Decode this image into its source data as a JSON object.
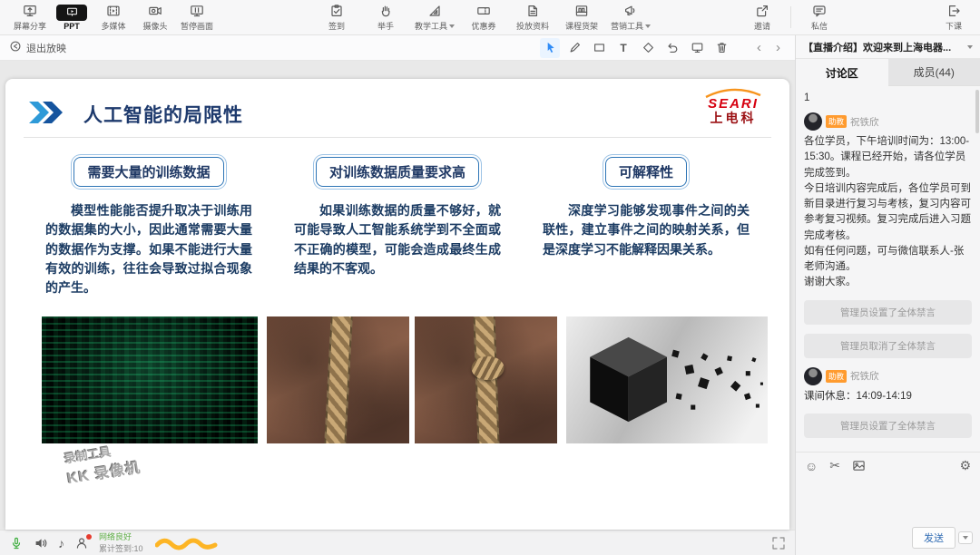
{
  "topbar": {
    "items_left": [
      {
        "label": "屏幕分享"
      },
      {
        "label": "PPT",
        "active": true
      },
      {
        "label": "多媒体"
      },
      {
        "label": "摄像头"
      },
      {
        "label": "暂停画面"
      }
    ],
    "items_center": [
      {
        "label": "签到"
      },
      {
        "label": "举手"
      },
      {
        "label": "教学工具",
        "has_dropdown": true
      },
      {
        "label": "优惠券"
      },
      {
        "label": "投放资料"
      },
      {
        "label": "课程货架"
      },
      {
        "label": "营销工具",
        "has_dropdown": true
      }
    ],
    "items_right": [
      {
        "label": "邀请"
      },
      {
        "label": "私信"
      },
      {
        "label": "下课"
      }
    ]
  },
  "presenter_bar": {
    "exit_label": "退出放映",
    "tools": [
      "select-tool",
      "pen-tool",
      "rectangle-tool",
      "text-tool",
      "eraser-tool",
      "undo-tool",
      "clear-screen-tool",
      "delete-annotations-tool"
    ],
    "selected_tool": "select-tool"
  },
  "icons": {
    "emoji": "☺",
    "cut": "✂",
    "settings": "⚙",
    "music": "♪",
    "prev": "‹",
    "next": "›",
    "text_tool": "T"
  },
  "slide": {
    "title": "人工智能的局限性",
    "logo_text": "SEARI",
    "logo_sub": "上电科",
    "columns": [
      {
        "heading": "需要大量的训练数据",
        "body": "模型性能能否提升取决于训练用的数据集的大小，因此通常需要大量的数据作为支撑。如果不能进行大量有效的训练，往往会导致过拟合现象的产生。"
      },
      {
        "heading": "对训练数据质量要求高",
        "body": "如果训练数据的质量不够好，就可能导致人工智能系统学到不全面或不正确的模型，可能会造成最终生成结果的不客观。"
      },
      {
        "heading": "可解释性",
        "body": "深度学习能够发现事件之间的关联性，建立事件之间的映射关系，但是深度学习不能解释因果关系。"
      }
    ],
    "watermark_line1": "录制工具",
    "watermark_line2": "KK 录像机"
  },
  "sidebar": {
    "header_title": "【直播介绍】欢迎来到上海电器...",
    "tabs": [
      {
        "label": "讨论区",
        "active": true
      },
      {
        "label": "成员(44)",
        "active": false
      }
    ],
    "messages": [
      {
        "type": "plain",
        "body": "1"
      },
      {
        "type": "user",
        "badge": "助教",
        "name": "祝铁欣",
        "body": "各位学员，下午培训时间为：13:00-15:30。课程已经开始，请各位学员完成签到。\n今日培训内容完成后，各位学员可到新目录进行复习与考核，复习内容可参考复习视频。复习完成后进入习题完成考核。\n如有任何问题，可与微信联系人-张老师沟通。\n谢谢大家。"
      },
      {
        "type": "system",
        "body": "管理员设置了全体禁言"
      },
      {
        "type": "system",
        "body": "管理员取消了全体禁言"
      },
      {
        "type": "user",
        "badge": "助教",
        "name": "祝铁欣",
        "body": "课间休息：14:09-14:19"
      },
      {
        "type": "system",
        "body": "管理员设置了全体禁言"
      }
    ],
    "send_label": "发送"
  },
  "status_bar": {
    "network_status": "网络良好",
    "checkin_count": "累计签到:10"
  },
  "colors": {
    "accent_blue": "#2e75b6",
    "title_navy": "#1f3864",
    "logo_red": "#d6000f",
    "badge_orange": "#ff9b2f",
    "highlighter": "#ffaa00"
  }
}
